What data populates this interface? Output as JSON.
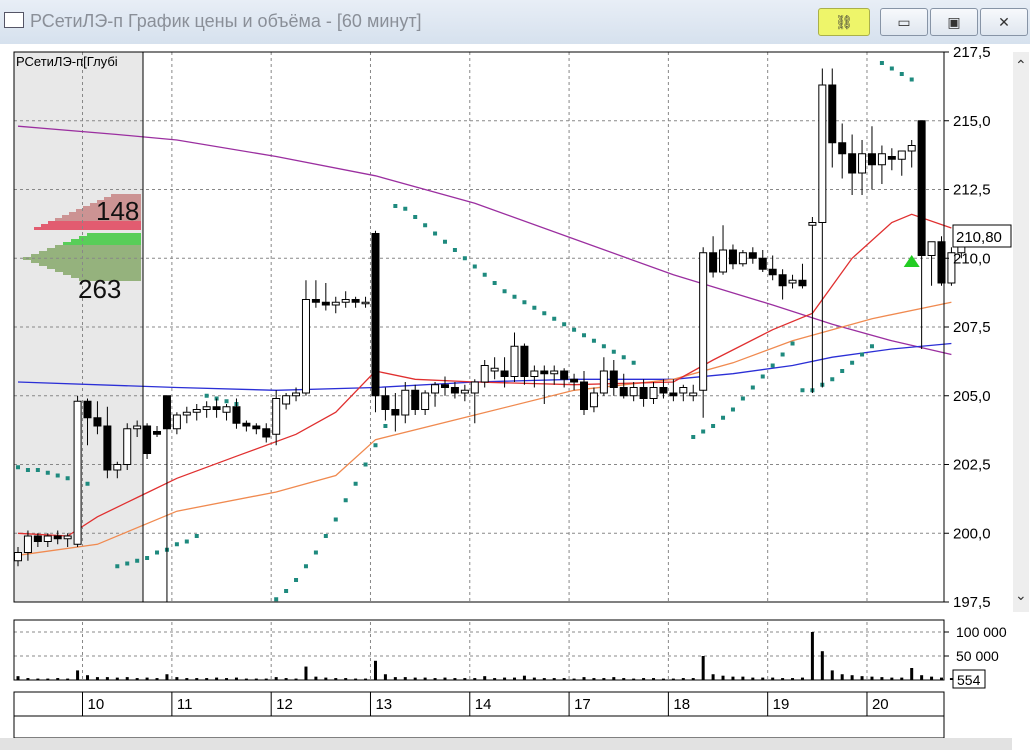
{
  "window": {
    "title": "РСетиЛЭ-п График цены и объёма - [60 минут]",
    "buttons": {
      "link_icon": "link-icon",
      "minimize": "minimize-icon",
      "maximize": "maximize-icon",
      "close": "close-icon"
    }
  },
  "chart_data": {
    "type": "candlestick",
    "instrument_label": "РСетиЛЭ-п[Глубі",
    "current_price_label": "210,80",
    "volume_current_label": "554",
    "price_axis": {
      "ticks": [
        "217,5",
        "215,0",
        "212,5",
        "210,0",
        "207,5",
        "205,0",
        "202,5",
        "200,0",
        "197,5"
      ],
      "range": [
        197.5,
        217.5
      ]
    },
    "volume_axis": {
      "ticks": [
        "100 000",
        "50 000"
      ],
      "range": [
        0,
        100000
      ]
    },
    "x_axis": {
      "labels": [
        "10",
        "11",
        "12",
        "13",
        "14",
        "17",
        "18",
        "19",
        "20"
      ],
      "label_bar_index": [
        7,
        16,
        26,
        36,
        46,
        56,
        66,
        76,
        86
      ]
    },
    "order_book": {
      "ask_total_label": "148",
      "bid_total_label": "263"
    },
    "colors": {
      "ma_purple": "#9b2fa0",
      "ma_blue": "#2b2fd6",
      "ma_red": "#e03030",
      "ma_orange": "#f08a50",
      "sar": "#1e8a7e",
      "grid": "#888888",
      "book_bg": "#e8e8e8"
    },
    "candles": [
      {
        "o": 199.0,
        "h": 199.5,
        "l": 198.8,
        "c": 199.3
      },
      {
        "o": 199.3,
        "h": 200.1,
        "l": 199.0,
        "c": 199.9
      },
      {
        "o": 199.9,
        "h": 200.0,
        "l": 199.5,
        "c": 199.7
      },
      {
        "o": 199.7,
        "h": 200.0,
        "l": 199.5,
        "c": 199.9
      },
      {
        "o": 199.9,
        "h": 200.1,
        "l": 199.6,
        "c": 199.8
      },
      {
        "o": 199.8,
        "h": 200.0,
        "l": 199.5,
        "c": 199.9
      },
      {
        "o": 199.6,
        "h": 205.0,
        "l": 199.5,
        "c": 204.8
      },
      {
        "o": 204.8,
        "h": 204.9,
        "l": 203.2,
        "c": 204.2
      },
      {
        "o": 204.2,
        "h": 204.8,
        "l": 203.6,
        "c": 203.9
      },
      {
        "o": 203.9,
        "h": 204.6,
        "l": 202.0,
        "c": 202.3
      },
      {
        "o": 202.3,
        "h": 202.6,
        "l": 202.0,
        "c": 202.5
      },
      {
        "o": 202.5,
        "h": 204.0,
        "l": 202.3,
        "c": 203.8
      },
      {
        "o": 203.8,
        "h": 204.1,
        "l": 203.5,
        "c": 203.9
      },
      {
        "o": 203.9,
        "h": 204.0,
        "l": 202.7,
        "c": 202.9
      },
      {
        "o": 203.7,
        "h": 203.9,
        "l": 203.5,
        "c": 203.6
      },
      {
        "o": 205.0,
        "h": 205.0,
        "l": 197.5,
        "c": 203.8
      },
      {
        "o": 203.8,
        "h": 204.4,
        "l": 203.6,
        "c": 204.3
      },
      {
        "o": 204.3,
        "h": 204.6,
        "l": 204.0,
        "c": 204.4
      },
      {
        "o": 204.4,
        "h": 204.7,
        "l": 204.1,
        "c": 204.5
      },
      {
        "o": 204.5,
        "h": 204.8,
        "l": 204.2,
        "c": 204.6
      },
      {
        "o": 204.6,
        "h": 204.9,
        "l": 204.2,
        "c": 204.5
      },
      {
        "o": 204.4,
        "h": 204.7,
        "l": 204.1,
        "c": 204.6
      },
      {
        "o": 204.6,
        "h": 204.9,
        "l": 203.8,
        "c": 204.0
      },
      {
        "o": 204.0,
        "h": 204.1,
        "l": 203.7,
        "c": 203.9
      },
      {
        "o": 203.9,
        "h": 204.0,
        "l": 203.6,
        "c": 203.8
      },
      {
        "o": 203.8,
        "h": 204.0,
        "l": 203.3,
        "c": 203.5
      },
      {
        "o": 203.6,
        "h": 205.2,
        "l": 203.2,
        "c": 204.9
      },
      {
        "o": 204.7,
        "h": 205.1,
        "l": 204.5,
        "c": 205.0
      },
      {
        "o": 205.0,
        "h": 205.3,
        "l": 204.8,
        "c": 205.1
      },
      {
        "o": 205.1,
        "h": 209.2,
        "l": 205.0,
        "c": 208.5
      },
      {
        "o": 208.5,
        "h": 209.2,
        "l": 208.2,
        "c": 208.4
      },
      {
        "o": 208.4,
        "h": 209.1,
        "l": 208.1,
        "c": 208.3
      },
      {
        "o": 208.3,
        "h": 208.6,
        "l": 208.0,
        "c": 208.4
      },
      {
        "o": 208.4,
        "h": 208.8,
        "l": 208.2,
        "c": 208.5
      },
      {
        "o": 208.5,
        "h": 208.6,
        "l": 208.2,
        "c": 208.4
      },
      {
        "o": 208.4,
        "h": 208.6,
        "l": 208.2,
        "c": 208.4
      },
      {
        "o": 210.9,
        "h": 211.0,
        "l": 204.4,
        "c": 205.0
      },
      {
        "o": 205.0,
        "h": 205.3,
        "l": 204.1,
        "c": 204.5
      },
      {
        "o": 204.5,
        "h": 205.1,
        "l": 203.7,
        "c": 204.3
      },
      {
        "o": 204.3,
        "h": 205.5,
        "l": 204.0,
        "c": 205.2
      },
      {
        "o": 205.2,
        "h": 205.4,
        "l": 204.3,
        "c": 204.5
      },
      {
        "o": 204.5,
        "h": 205.2,
        "l": 204.3,
        "c": 205.1
      },
      {
        "o": 205.1,
        "h": 205.5,
        "l": 204.6,
        "c": 205.4
      },
      {
        "o": 205.4,
        "h": 205.7,
        "l": 205.0,
        "c": 205.3
      },
      {
        "o": 205.3,
        "h": 205.5,
        "l": 204.9,
        "c": 205.1
      },
      {
        "o": 205.1,
        "h": 205.4,
        "l": 204.8,
        "c": 205.2
      },
      {
        "o": 205.1,
        "h": 205.6,
        "l": 204.0,
        "c": 205.5
      },
      {
        "o": 205.5,
        "h": 206.3,
        "l": 205.3,
        "c": 206.1
      },
      {
        "o": 205.9,
        "h": 206.4,
        "l": 205.6,
        "c": 206.0
      },
      {
        "o": 205.9,
        "h": 206.4,
        "l": 205.3,
        "c": 205.7
      },
      {
        "o": 205.7,
        "h": 207.3,
        "l": 205.5,
        "c": 206.8
      },
      {
        "o": 206.8,
        "h": 206.9,
        "l": 205.4,
        "c": 205.7
      },
      {
        "o": 205.7,
        "h": 206.1,
        "l": 205.3,
        "c": 205.9
      },
      {
        "o": 205.9,
        "h": 206.1,
        "l": 204.7,
        "c": 205.8
      },
      {
        "o": 205.8,
        "h": 206.1,
        "l": 205.4,
        "c": 205.9
      },
      {
        "o": 205.9,
        "h": 206.0,
        "l": 205.3,
        "c": 205.6
      },
      {
        "o": 205.6,
        "h": 205.8,
        "l": 205.2,
        "c": 205.5
      },
      {
        "o": 205.5,
        "h": 205.9,
        "l": 204.3,
        "c": 204.5
      },
      {
        "o": 204.6,
        "h": 205.3,
        "l": 204.4,
        "c": 205.1
      },
      {
        "o": 205.1,
        "h": 206.4,
        "l": 205.0,
        "c": 205.9
      },
      {
        "o": 205.9,
        "h": 206.3,
        "l": 205.0,
        "c": 205.3
      },
      {
        "o": 205.3,
        "h": 205.8,
        "l": 204.9,
        "c": 205.0
      },
      {
        "o": 205.0,
        "h": 205.5,
        "l": 204.8,
        "c": 205.3
      },
      {
        "o": 205.3,
        "h": 205.6,
        "l": 204.6,
        "c": 204.9
      },
      {
        "o": 204.9,
        "h": 205.5,
        "l": 204.7,
        "c": 205.3
      },
      {
        "o": 205.3,
        "h": 205.6,
        "l": 204.9,
        "c": 205.1
      },
      {
        "o": 205.1,
        "h": 205.6,
        "l": 204.8,
        "c": 205.0
      },
      {
        "o": 205.1,
        "h": 205.4,
        "l": 204.8,
        "c": 205.3
      },
      {
        "o": 205.0,
        "h": 205.4,
        "l": 204.8,
        "c": 205.1
      },
      {
        "o": 205.2,
        "h": 210.4,
        "l": 204.2,
        "c": 210.2
      },
      {
        "o": 210.2,
        "h": 210.8,
        "l": 209.3,
        "c": 209.5
      },
      {
        "o": 209.5,
        "h": 211.2,
        "l": 209.4,
        "c": 210.3
      },
      {
        "o": 210.3,
        "h": 210.5,
        "l": 209.6,
        "c": 209.8
      },
      {
        "o": 209.8,
        "h": 210.3,
        "l": 209.7,
        "c": 210.2
      },
      {
        "o": 210.2,
        "h": 210.4,
        "l": 209.8,
        "c": 210.0
      },
      {
        "o": 210.0,
        "h": 210.3,
        "l": 209.5,
        "c": 209.6
      },
      {
        "o": 209.6,
        "h": 210.1,
        "l": 209.2,
        "c": 209.4
      },
      {
        "o": 209.4,
        "h": 209.6,
        "l": 208.5,
        "c": 209.0
      },
      {
        "o": 209.1,
        "h": 209.4,
        "l": 208.9,
        "c": 209.2
      },
      {
        "o": 209.2,
        "h": 209.8,
        "l": 208.9,
        "c": 209.0
      },
      {
        "o": 211.2,
        "h": 211.5,
        "l": 205.1,
        "c": 211.3
      },
      {
        "o": 211.3,
        "h": 216.9,
        "l": 205.3,
        "c": 216.3
      },
      {
        "o": 216.3,
        "h": 216.9,
        "l": 213.3,
        "c": 214.2
      },
      {
        "o": 214.2,
        "h": 214.9,
        "l": 212.9,
        "c": 213.8
      },
      {
        "o": 213.8,
        "h": 214.5,
        "l": 212.3,
        "c": 213.1
      },
      {
        "o": 213.1,
        "h": 214.3,
        "l": 212.3,
        "c": 213.8
      },
      {
        "o": 213.8,
        "h": 214.8,
        "l": 212.5,
        "c": 213.4
      },
      {
        "o": 213.4,
        "h": 214.1,
        "l": 212.7,
        "c": 213.8
      },
      {
        "o": 213.7,
        "h": 214.0,
        "l": 213.2,
        "c": 213.6
      },
      {
        "o": 213.6,
        "h": 213.9,
        "l": 213.0,
        "c": 213.9
      },
      {
        "o": 213.9,
        "h": 214.3,
        "l": 213.3,
        "c": 214.1
      },
      {
        "o": 215.0,
        "h": 215.0,
        "l": 206.7,
        "c": 210.1
      },
      {
        "o": 210.1,
        "h": 210.6,
        "l": 209.0,
        "c": 210.6
      },
      {
        "o": 210.6,
        "h": 210.8,
        "l": 209.0,
        "c": 209.1
      },
      {
        "o": 209.1,
        "h": 210.4,
        "l": 209.0,
        "c": 210.2
      },
      {
        "o": 210.2,
        "h": 210.8,
        "l": 210.0,
        "c": 210.8
      }
    ],
    "volumes": [
      8,
      4,
      3,
      3,
      4,
      3,
      20,
      10,
      6,
      6,
      5,
      6,
      4,
      5,
      4,
      12,
      6,
      4,
      4,
      4,
      5,
      4,
      5,
      3,
      3,
      3,
      6,
      4,
      3,
      28,
      7,
      5,
      4,
      4,
      3,
      3,
      40,
      12,
      6,
      6,
      5,
      5,
      4,
      5,
      4,
      4,
      4,
      8,
      4,
      5,
      5,
      9,
      5,
      4,
      4,
      4,
      3,
      6,
      4,
      4,
      6,
      4,
      3,
      4,
      4,
      3,
      3,
      4,
      4,
      50,
      12,
      9,
      7,
      7,
      5,
      5,
      5,
      4,
      4,
      5,
      100,
      60,
      20,
      12,
      10,
      8,
      7,
      6,
      5,
      5,
      25,
      10,
      7,
      5,
      4
    ],
    "sar": [
      {
        "i": 0,
        "v": 202.4
      },
      {
        "i": 1,
        "v": 202.3
      },
      {
        "i": 2,
        "v": 202.3
      },
      {
        "i": 3,
        "v": 202.2
      },
      {
        "i": 4,
        "v": 202.1
      },
      {
        "i": 5,
        "v": 202.0
      },
      {
        "i": 6,
        "v": 201.9
      },
      {
        "i": 7,
        "v": 201.8
      },
      {
        "i": 10,
        "v": 198.8
      },
      {
        "i": 11,
        "v": 198.9
      },
      {
        "i": 12,
        "v": 199.0
      },
      {
        "i": 13,
        "v": 199.1
      },
      {
        "i": 14,
        "v": 199.3
      },
      {
        "i": 15,
        "v": 199.4
      },
      {
        "i": 16,
        "v": 199.6
      },
      {
        "i": 17,
        "v": 199.7
      },
      {
        "i": 18,
        "v": 199.9
      },
      {
        "i": 19,
        "v": 205.0
      },
      {
        "i": 20,
        "v": 204.9
      },
      {
        "i": 21,
        "v": 204.8
      },
      {
        "i": 22,
        "v": 204.7
      },
      {
        "i": 26,
        "v": 197.6
      },
      {
        "i": 27,
        "v": 197.9
      },
      {
        "i": 28,
        "v": 198.3
      },
      {
        "i": 29,
        "v": 198.8
      },
      {
        "i": 30,
        "v": 199.3
      },
      {
        "i": 31,
        "v": 199.9
      },
      {
        "i": 32,
        "v": 200.5
      },
      {
        "i": 33,
        "v": 201.2
      },
      {
        "i": 34,
        "v": 201.8
      },
      {
        "i": 35,
        "v": 202.5
      },
      {
        "i": 36,
        "v": 203.2
      },
      {
        "i": 37,
        "v": 203.9
      },
      {
        "i": 38,
        "v": 211.9
      },
      {
        "i": 39,
        "v": 211.8
      },
      {
        "i": 40,
        "v": 211.5
      },
      {
        "i": 41,
        "v": 211.2
      },
      {
        "i": 42,
        "v": 210.9
      },
      {
        "i": 43,
        "v": 210.6
      },
      {
        "i": 44,
        "v": 210.3
      },
      {
        "i": 45,
        "v": 210.0
      },
      {
        "i": 46,
        "v": 209.7
      },
      {
        "i": 47,
        "v": 209.4
      },
      {
        "i": 48,
        "v": 209.1
      },
      {
        "i": 49,
        "v": 208.8
      },
      {
        "i": 50,
        "v": 208.6
      },
      {
        "i": 51,
        "v": 208.4
      },
      {
        "i": 52,
        "v": 208.2
      },
      {
        "i": 53,
        "v": 208.0
      },
      {
        "i": 54,
        "v": 207.8
      },
      {
        "i": 55,
        "v": 207.6
      },
      {
        "i": 56,
        "v": 207.4
      },
      {
        "i": 57,
        "v": 207.2
      },
      {
        "i": 58,
        "v": 207.0
      },
      {
        "i": 59,
        "v": 206.8
      },
      {
        "i": 60,
        "v": 206.6
      },
      {
        "i": 61,
        "v": 206.4
      },
      {
        "i": 62,
        "v": 206.2
      },
      {
        "i": 68,
        "v": 203.5
      },
      {
        "i": 69,
        "v": 203.7
      },
      {
        "i": 70,
        "v": 203.9
      },
      {
        "i": 71,
        "v": 204.2
      },
      {
        "i": 72,
        "v": 204.5
      },
      {
        "i": 73,
        "v": 204.9
      },
      {
        "i": 74,
        "v": 205.3
      },
      {
        "i": 75,
        "v": 205.7
      },
      {
        "i": 76,
        "v": 206.1
      },
      {
        "i": 77,
        "v": 206.5
      },
      {
        "i": 78,
        "v": 206.9
      },
      {
        "i": 79,
        "v": 205.2
      },
      {
        "i": 80,
        "v": 205.2
      },
      {
        "i": 81,
        "v": 205.4
      },
      {
        "i": 82,
        "v": 205.6
      },
      {
        "i": 83,
        "v": 205.9
      },
      {
        "i": 84,
        "v": 206.2
      },
      {
        "i": 85,
        "v": 206.5
      },
      {
        "i": 86,
        "v": 206.8
      },
      {
        "i": 87,
        "v": 217.1
      },
      {
        "i": 88,
        "v": 216.9
      },
      {
        "i": 89,
        "v": 216.7
      },
      {
        "i": 90,
        "v": 216.5
      }
    ],
    "ma_purple": [
      [
        0,
        214.8
      ],
      [
        10,
        214.5
      ],
      [
        16,
        214.3
      ],
      [
        26,
        213.7
      ],
      [
        36,
        213.0
      ],
      [
        46,
        212.0
      ],
      [
        56,
        210.7
      ],
      [
        66,
        209.4
      ],
      [
        76,
        208.3
      ],
      [
        82,
        207.6
      ],
      [
        88,
        207.0
      ],
      [
        94,
        206.5
      ]
    ],
    "ma_blue": [
      [
        0,
        205.5
      ],
      [
        16,
        205.3
      ],
      [
        26,
        205.2
      ],
      [
        36,
        205.3
      ],
      [
        46,
        205.5
      ],
      [
        56,
        205.6
      ],
      [
        66,
        205.6
      ],
      [
        72,
        205.8
      ],
      [
        78,
        206.1
      ],
      [
        82,
        206.4
      ],
      [
        88,
        206.7
      ],
      [
        94,
        206.9
      ]
    ],
    "ma_red": [
      [
        0,
        200.0
      ],
      [
        5,
        199.9
      ],
      [
        8,
        200.6
      ],
      [
        12,
        201.3
      ],
      [
        16,
        202.0
      ],
      [
        22,
        202.8
      ],
      [
        28,
        203.6
      ],
      [
        32,
        204.4
      ],
      [
        36,
        205.9
      ],
      [
        40,
        205.6
      ],
      [
        46,
        205.5
      ],
      [
        56,
        205.4
      ],
      [
        66,
        205.5
      ],
      [
        70,
        206.3
      ],
      [
        76,
        207.4
      ],
      [
        80,
        208.0
      ],
      [
        84,
        210.0
      ],
      [
        88,
        211.3
      ],
      [
        90,
        211.6
      ],
      [
        94,
        211.1
      ]
    ],
    "ma_orange": [
      [
        0,
        199.2
      ],
      [
        8,
        199.6
      ],
      [
        16,
        200.8
      ],
      [
        26,
        201.5
      ],
      [
        32,
        202.1
      ],
      [
        36,
        203.4
      ],
      [
        46,
        204.3
      ],
      [
        56,
        205.2
      ],
      [
        66,
        205.6
      ],
      [
        72,
        206.2
      ],
      [
        78,
        207.0
      ],
      [
        86,
        207.8
      ],
      [
        94,
        208.4
      ]
    ],
    "signal_marker": {
      "bar_index": 90,
      "price": 209.9
    }
  }
}
